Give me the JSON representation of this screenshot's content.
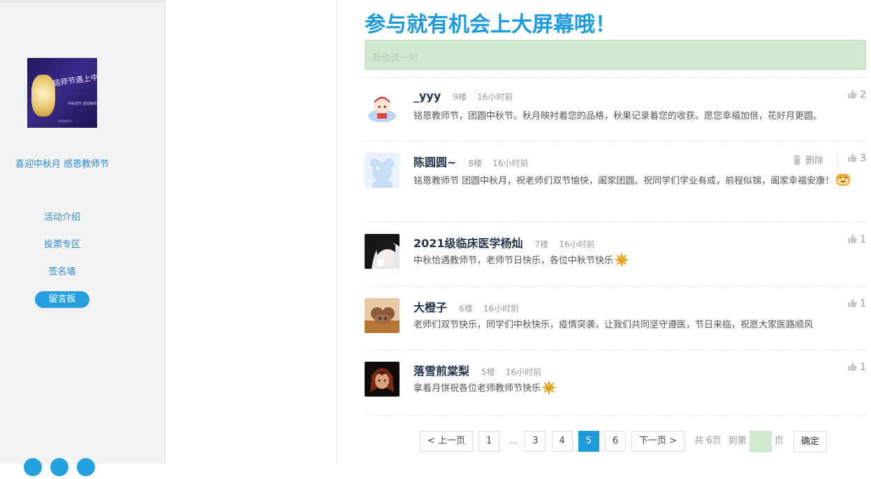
{
  "sidebar": {
    "poster": {
      "script_text": "铭师节遇上中秋节",
      "sub_text": "中秋佳节 感恩教师",
      "foot_text": "铭恩教师节"
    },
    "event_title": "喜迎中秋月 感恩教师节",
    "nav": [
      {
        "label": "活动介绍",
        "active": false
      },
      {
        "label": "投票专区",
        "active": false
      },
      {
        "label": "签名墙",
        "active": false
      },
      {
        "label": "留言板",
        "active": true
      }
    ]
  },
  "main": {
    "headline": "参与就有机会上大屏幕哦！",
    "comment_placeholder": "我也说一句",
    "comments": [
      {
        "name": "_yyy",
        "floor": "9楼",
        "time": "16小时前",
        "text": "铭恩教师节，团圆中秋节。秋月映衬着您的品格，秋果记录着您的收获。愿您幸福加倍，花好月更圆。",
        "likes": "2",
        "emoji": "",
        "delete_label": ""
      },
      {
        "name": "陈圆圆~",
        "floor": "8楼",
        "time": "16小时前",
        "text": "铭恩教师节 团圆中秋月，祝老师们双节愉快，阖家团圆。祝同学们学业有成，前程似锦，阖家幸福安康！",
        "likes": "3",
        "emoji": "shy-face-icon",
        "delete_label": "删除"
      },
      {
        "name": "2021级临床医学杨灿",
        "floor": "7楼",
        "time": "16小时前",
        "text": "中秋恰遇教师节，老师节日快乐，各位中秋节快乐",
        "likes": "1",
        "emoji": "sun-icon",
        "delete_label": ""
      },
      {
        "name": "大橙子",
        "floor": "6楼",
        "time": "16小时前",
        "text": "老师们双节快乐，同学们中秋快乐，疫情突袭，让我们共同坚守遵医，节日来临，祝愿大家医路顺风",
        "likes": "1",
        "emoji": "",
        "delete_label": ""
      },
      {
        "name": "落雪煎棠梨",
        "floor": "5楼",
        "time": "16小时前",
        "text": "拿着月饼祝各位老师教师节快乐",
        "likes": "1",
        "emoji": "sun-icon",
        "delete_label": ""
      }
    ]
  },
  "pager": {
    "prev": "< 上一页",
    "first": "1",
    "ellipsis": "...",
    "pages": [
      "3",
      "4",
      "5",
      "6"
    ],
    "current": "5",
    "next": "下一页 >",
    "total": "共 6页",
    "goto_prefix": "到第",
    "goto_suffix": "页",
    "confirm": "确定"
  },
  "colors": {
    "accent": "#1e9bdd",
    "input_bg": "#cfe9cf",
    "sidebar_bg": "#f3f3f3"
  }
}
